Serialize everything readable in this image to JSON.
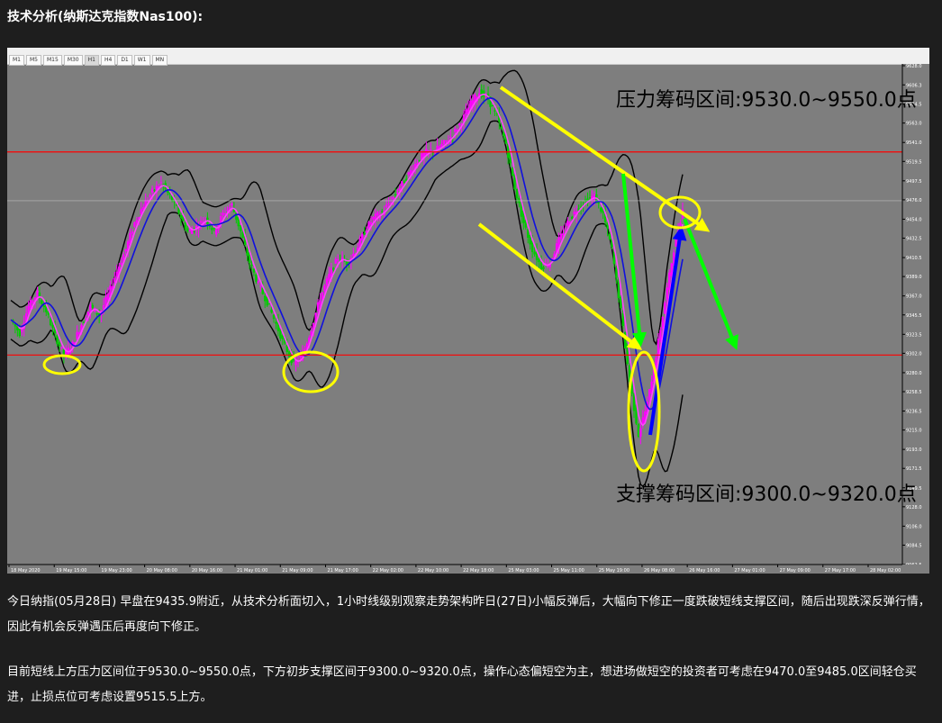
{
  "heading": "技术分析(纳斯达克指数Nas100):",
  "timeframes": [
    "M1",
    "M5",
    "M15",
    "M30",
    "H1",
    "H4",
    "D1",
    "W1",
    "MN"
  ],
  "active_timeframe": "H1",
  "chart_data": {
    "type": "candlestick",
    "price_ticks": [
      "9628.0",
      "9606.3",
      "9584.5",
      "9563.0",
      "9541.0",
      "9519.5",
      "9497.5",
      "9476.0",
      "9454.0",
      "9432.5",
      "9410.5",
      "9389.0",
      "9367.0",
      "9345.5",
      "9323.5",
      "9302.0",
      "9280.0",
      "9258.5",
      "9236.5",
      "9215.0",
      "9193.0",
      "9171.5",
      "9149.5",
      "9128.0",
      "9106.0",
      "9084.5",
      "9062.5"
    ],
    "ylim": [
      9062.5,
      9628.0
    ],
    "current_price_label": "9474.9",
    "resistance_line_label": "9530.3",
    "support_line_label": "9300.0",
    "time_ticks": [
      "18 May 2020",
      "19 May 15:00",
      "19 May 23:00",
      "20 May 08:00",
      "20 May 16:00",
      "21 May 01:00",
      "21 May 09:00",
      "21 May 17:00",
      "22 May 02:00",
      "22 May 10:00",
      "22 May 18:00",
      "25 May 03:00",
      "25 May 11:00",
      "25 May 19:00",
      "26 May 08:00",
      "26 May 16:00",
      "27 May 01:00",
      "27 May 09:00",
      "27 May 17:00",
      "28 May 02:00"
    ],
    "close_series": [
      9340,
      9325,
      9355,
      9370,
      9350,
      9322,
      9300,
      9312,
      9335,
      9355,
      9345,
      9368,
      9395,
      9420,
      9450,
      9470,
      9485,
      9495,
      9480,
      9462,
      9440,
      9445,
      9455,
      9440,
      9460,
      9470,
      9440,
      9405,
      9380,
      9360,
      9335,
      9310,
      9290,
      9300,
      9330,
      9365,
      9390,
      9410,
      9405,
      9418,
      9440,
      9455,
      9462,
      9475,
      9490,
      9505,
      9520,
      9530,
      9532,
      9540,
      9550,
      9565,
      9585,
      9598,
      9590,
      9570,
      9540,
      9490,
      9450,
      9420,
      9400,
      9405,
      9430,
      9450,
      9465,
      9475,
      9480,
      9460,
      9420,
      9350,
      9270,
      9210,
      9245,
      9300,
      9360,
      9420,
      9465
    ],
    "upper_band_label": "",
    "resistance_zone_text": "压力筹码区间:9530.0~9550.0点",
    "support_zone_text": "支撑筹码区间:9300.0~9320.0点"
  },
  "paragraphs": [
    "今日纳指(05月28日) 早盘在9435.9附近，从技术分析面切入，1小时线级别观察走势架构昨日(27日)小幅反弹后，大幅向下修正一度跌破短线支撑区间，随后出现跌深反弹行情，因此有机会反弹遇压后再度向下修正。",
    "目前短线上方压力区间位于9530.0~9550.0点，下方初步支撑区间于9300.0~9320.0点，操作心态偏短空为主，想进场做短空的投资者可考虑在9470.0至9485.0区间轻仓买进，止损点位可考虑设置9515.5上方。"
  ],
  "colors": {
    "chart_bg": "#7e7e7e",
    "bull_candle": "#ff00ff",
    "bear_candle": "#00cc00",
    "ma_fast": "#ff44ff",
    "ma_slow": "#1010dd",
    "bands": "#000000",
    "level_lines": "#ff0000",
    "annotation_yellow": "#ffff00",
    "arrow_green": "#00ff00",
    "arrow_blue": "#0000ff"
  }
}
